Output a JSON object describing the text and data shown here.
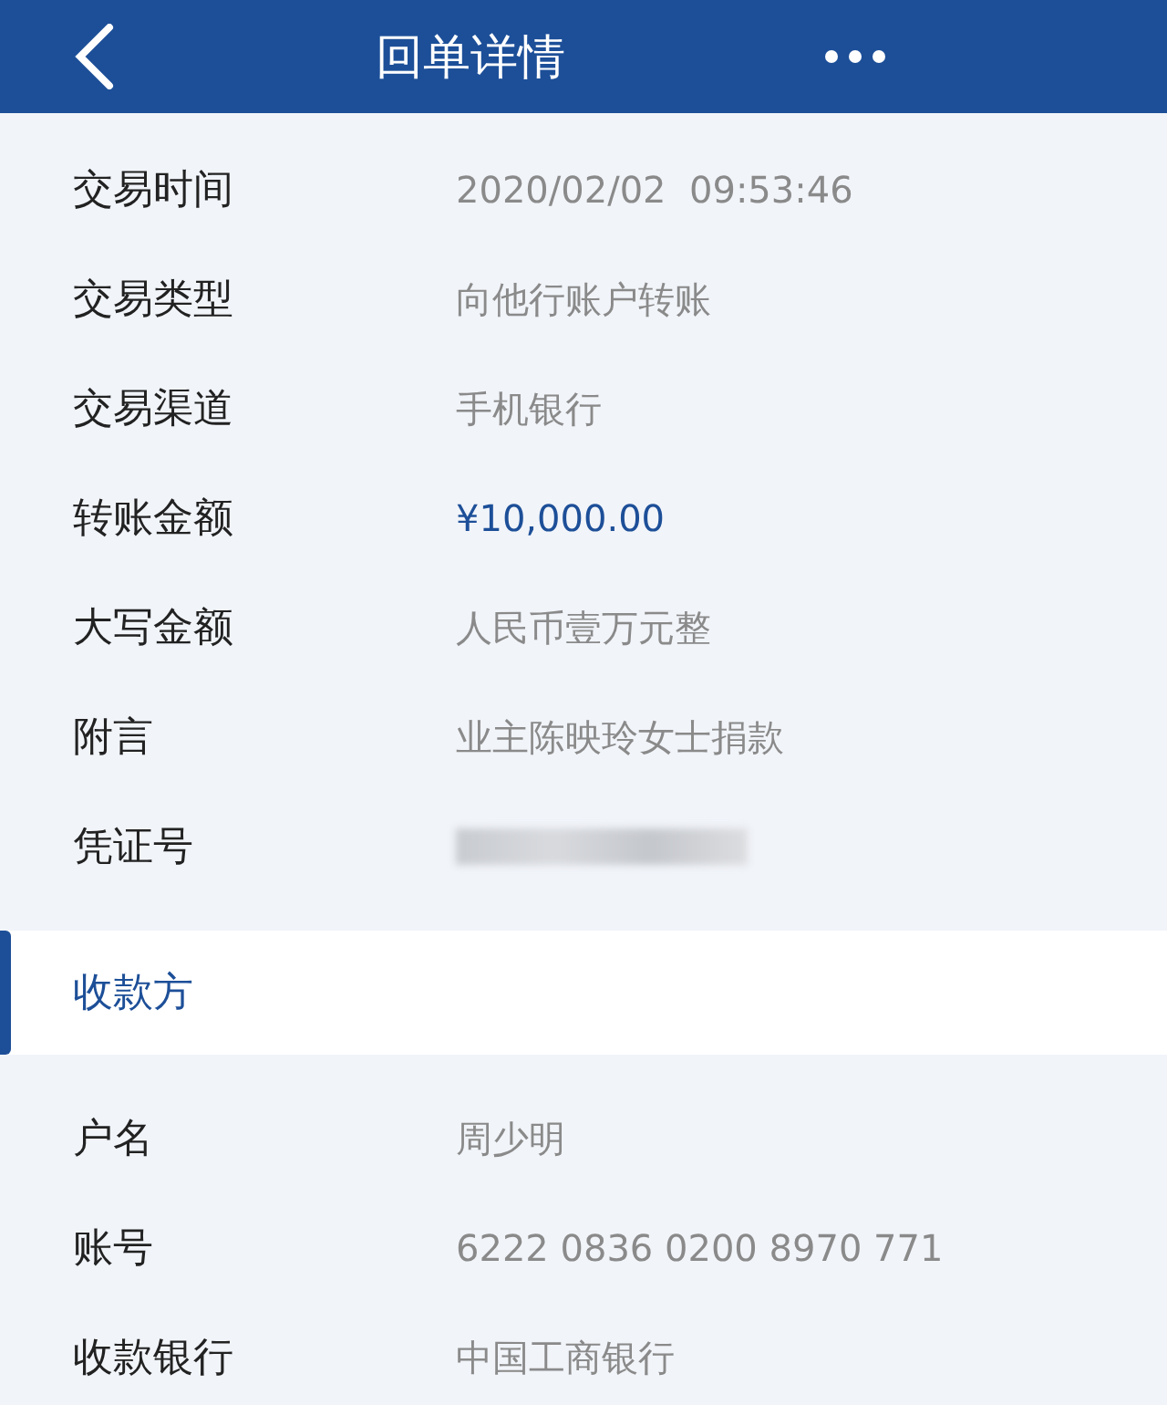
{
  "header": {
    "title": "回单详情"
  },
  "details": [
    {
      "label": "交易时间",
      "value": "2020/02/02  09:53:46",
      "kind": "text"
    },
    {
      "label": "交易类型",
      "value": "向他行账户转账",
      "kind": "text"
    },
    {
      "label": "交易渠道",
      "value": "手机银行",
      "kind": "text"
    },
    {
      "label": "转账金额",
      "value": "¥10,000.00",
      "kind": "amount"
    },
    {
      "label": "大写金额",
      "value": "人民币壹万元整",
      "kind": "text"
    },
    {
      "label": "附言",
      "value": "业主陈映玲女士捐款",
      "kind": "text"
    },
    {
      "label": "凭证号",
      "kind": "redacted"
    }
  ],
  "section": {
    "title": "收款方"
  },
  "payee": [
    {
      "label": "户名",
      "value": "周少明",
      "kind": "text"
    },
    {
      "label": "账号",
      "value": "6222 0836 0200 8970 771",
      "kind": "text"
    },
    {
      "label": "收款银行",
      "value": "中国工商银行",
      "kind": "text"
    }
  ]
}
